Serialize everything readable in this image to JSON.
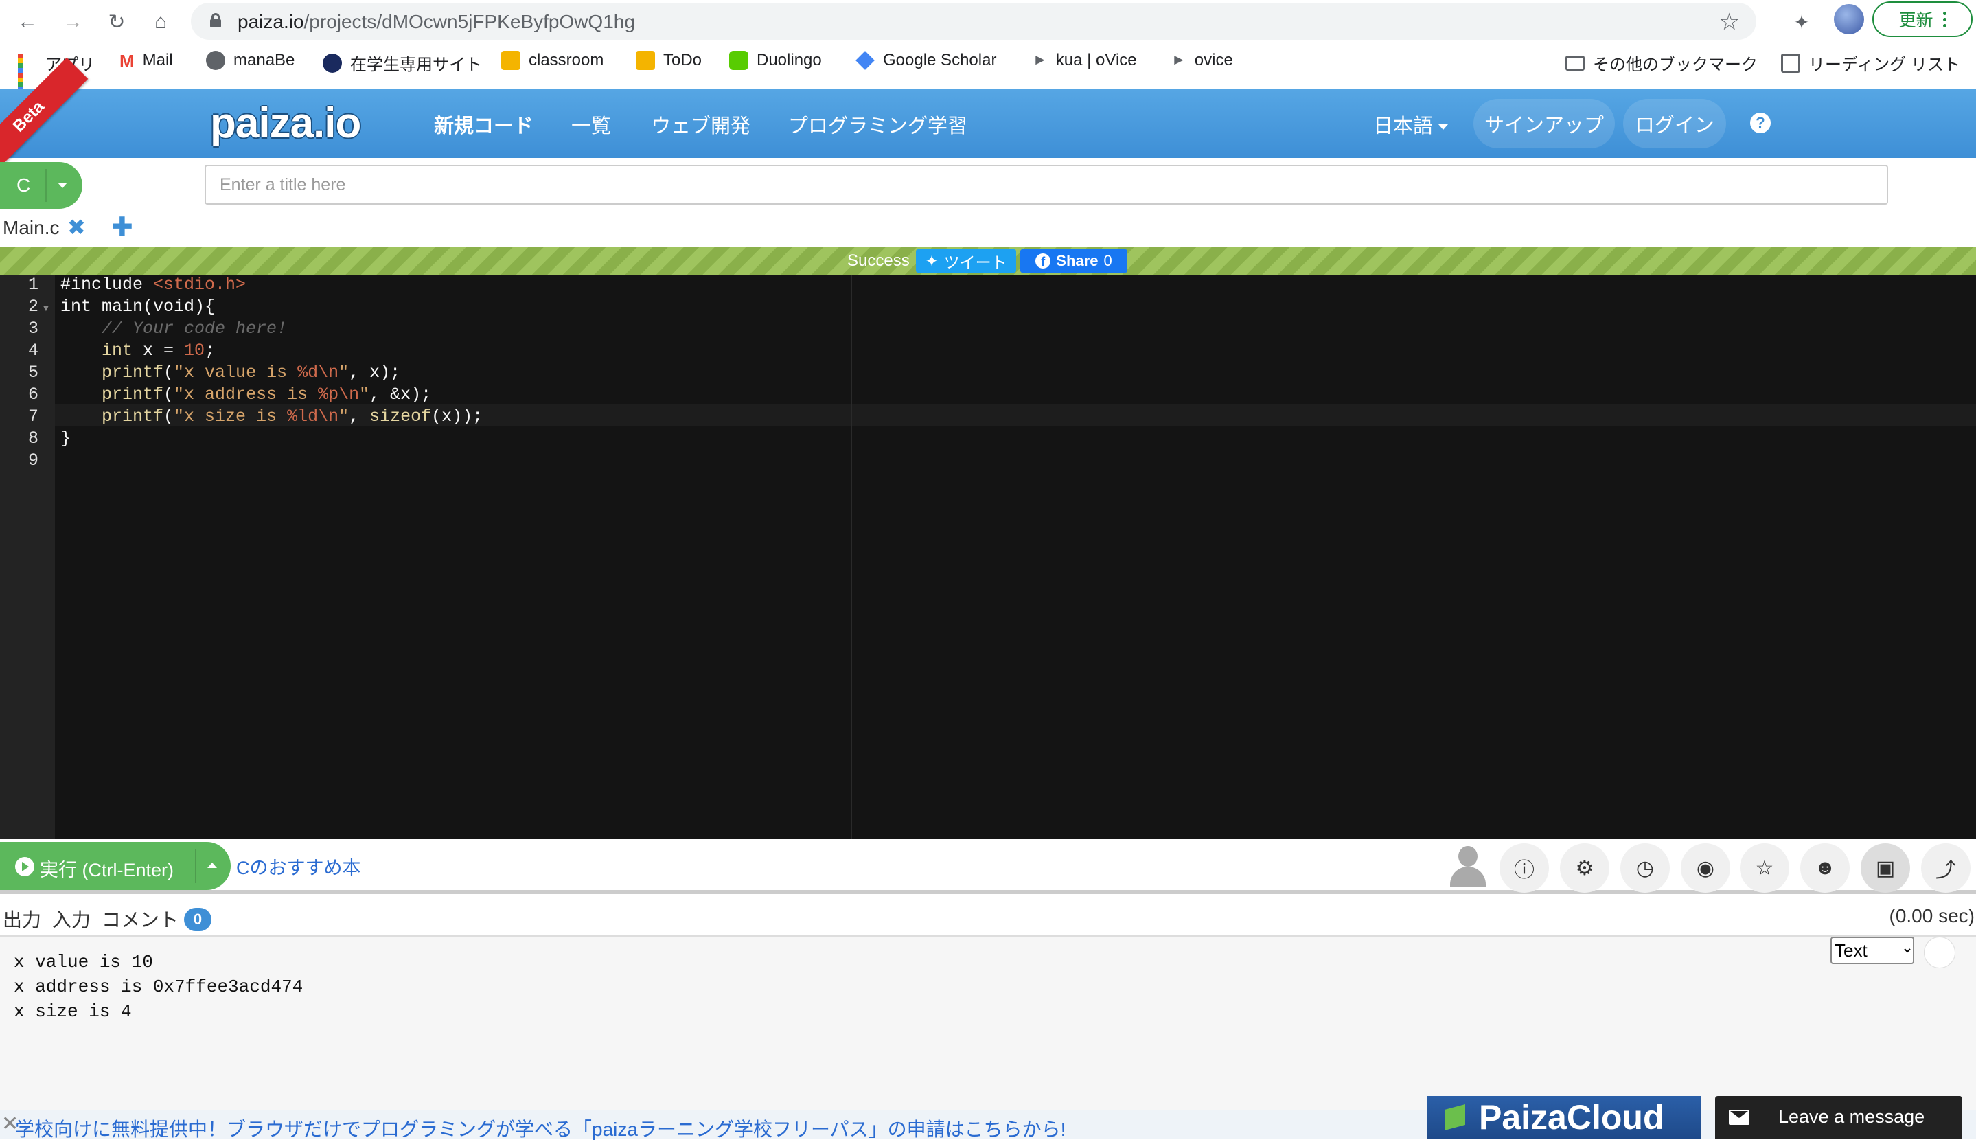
{
  "browser": {
    "url_host": "paiza.io",
    "url_path": "/projects/dMOcwn5jFPKeByfpOwQ1hg",
    "update_label": "更新"
  },
  "bookmarks": [
    {
      "label": "アプリ",
      "icon": "apps-grid-icon"
    },
    {
      "label": "Mail",
      "icon": "gmail-icon"
    },
    {
      "label": "manaBe",
      "icon": "globe-icon"
    },
    {
      "label": "在学生専用サイト",
      "icon": "site-icon"
    },
    {
      "label": "classroom",
      "icon": "classroom-icon"
    },
    {
      "label": "ToDo",
      "icon": "classroom-icon"
    },
    {
      "label": "Duolingo",
      "icon": "duolingo-icon"
    },
    {
      "label": "Google Scholar",
      "icon": "scholar-icon"
    },
    {
      "label": "kua | oVice",
      "icon": "ovice-icon"
    },
    {
      "label": "ovice",
      "icon": "ovice-icon"
    }
  ],
  "bookmarks_right": {
    "other": "その他のブックマーク",
    "reading": "リーディング リスト"
  },
  "header": {
    "beta": "Beta",
    "logo": "paiza.io",
    "nav": [
      "新規コード",
      "一覧",
      "ウェブ開発",
      "プログラミング学習"
    ],
    "language": "日本語",
    "signup": "サインアップ",
    "login": "ログイン",
    "help": "?"
  },
  "toolbar": {
    "language": "C",
    "title_placeholder": "Enter a title here",
    "file_tab": "Main.c"
  },
  "status": {
    "text": "Success",
    "tweet": "ツイート",
    "share": "Share",
    "share_count": "0"
  },
  "editor": {
    "line_numbers": [
      "1",
      "2",
      "3",
      "4",
      "5",
      "6",
      "7",
      "8",
      "9"
    ]
  },
  "run": {
    "label": "実行 (Ctrl-Enter)",
    "book_link": "Cのおすすめ本"
  },
  "tool_icons": [
    "info-icon",
    "settings-icon",
    "history-icon",
    "github-icon",
    "star-icon",
    "users-icon",
    "lock-icon",
    "share-icon"
  ],
  "output": {
    "tabs": [
      "出力",
      "入力",
      "コメント"
    ],
    "comment_count": "0",
    "time": "(0.00 sec)",
    "format": "Text",
    "lines": [
      "x value is 10",
      "x address is 0x7ffee3acd474",
      "x size is 4"
    ]
  },
  "banner": {
    "text": "学校向けに無料提供中！ブラウザだけでプログラミングが学べる「paizaラーニング学校フリーパス」の申請はこちらから!",
    "cloud": "PaizaCloud",
    "message": "Leave a message"
  },
  "colors": {
    "header_blue": "#4a9ade",
    "run_green": "#5cb85c",
    "status_green": "#8ab04a",
    "editor_bg": "#141414"
  }
}
